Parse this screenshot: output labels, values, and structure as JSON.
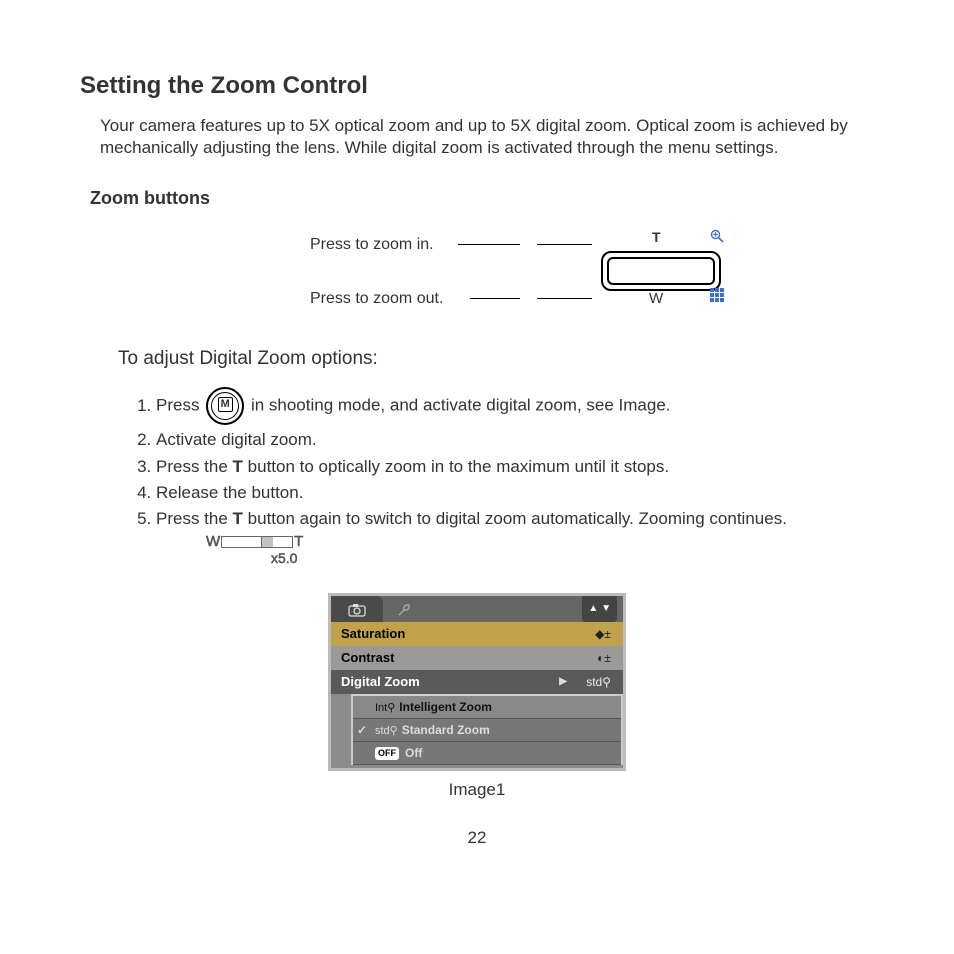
{
  "title": "Setting the Zoom Control",
  "intro": "Your camera features up to 5X optical zoom and up to 5X digital zoom. Optical zoom is achieved by mechanically adjusting the lens. While digital zoom is activated through the menu settings.",
  "section_zoom_buttons": "Zoom buttons",
  "labels": {
    "zoom_in": "Press to zoom in.",
    "zoom_out": "Press to zoom out.",
    "t": "T",
    "w": "W"
  },
  "subheading": "To adjust Digital Zoom options:",
  "steps": {
    "s1a": "Press",
    "s1b": " in shooting mode, and activate digital zoom, see Image.",
    "m": "M",
    "s2": "Activate digital zoom.",
    "s3a": "Press the ",
    "s3b": "T",
    "s3c": " button to optically zoom in to the maximum until it stops.",
    "s4": "Release the button.",
    "s5a": "Press the ",
    "s5b": "T",
    "s5c": " button again to switch to digital zoom automatically. Zooming continues."
  },
  "zoom_bar": {
    "w": "W",
    "t": "T",
    "value": "x5.0"
  },
  "menu": {
    "nav": "▲ ▼",
    "rows": {
      "saturation": "Saturation",
      "saturation_icon": "◆±",
      "contrast": "Contrast",
      "contrast_icon": "◐±",
      "digital_zoom": "Digital Zoom",
      "dz_icon": "std⚲"
    },
    "popup": {
      "intelligent": "Intelligent Zoom",
      "intelligent_icon": "Int⚲",
      "standard": "Standard Zoom",
      "standard_icon": "std⚲",
      "off": "Off",
      "off_badge": "OFF"
    }
  },
  "caption": "Image1",
  "page": "22"
}
